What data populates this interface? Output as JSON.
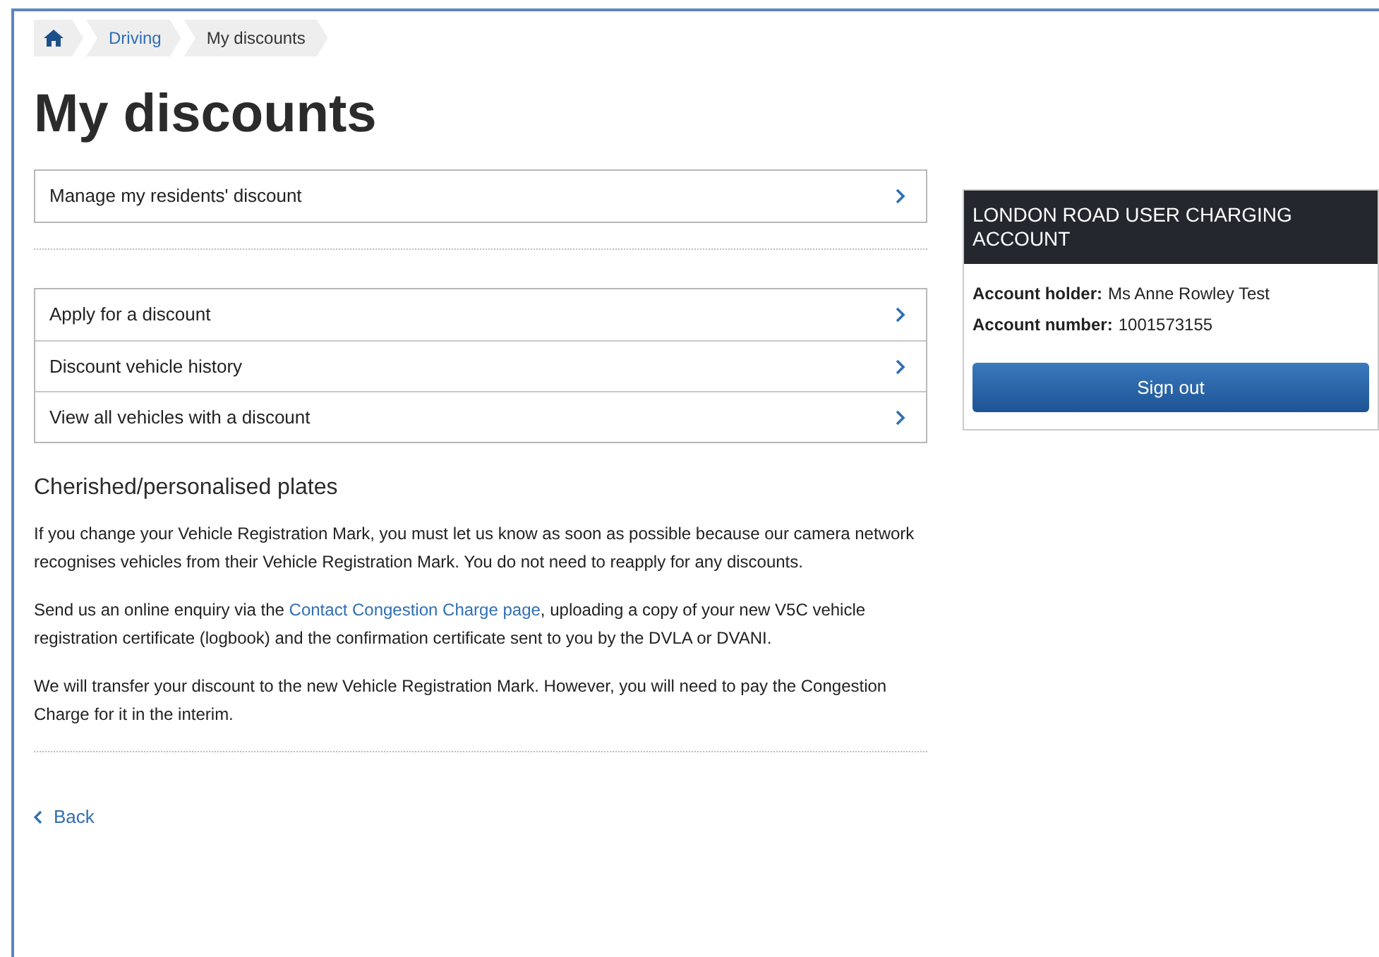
{
  "breadcrumb": [
    {
      "kind": "home"
    },
    {
      "kind": "link",
      "label": "Driving"
    },
    {
      "kind": "current",
      "label": "My discounts"
    }
  ],
  "title": "My discounts",
  "primary_links": [
    {
      "label": "Manage my residents' discount"
    }
  ],
  "secondary_links": [
    {
      "label": "Apply for a discount"
    },
    {
      "label": "Discount vehicle history"
    },
    {
      "label": "View all vehicles with a discount"
    }
  ],
  "section": {
    "heading": "Cherished/personalised plates",
    "paragraphs": [
      {
        "text": "If you change your Vehicle Registration Mark, you must let us know as soon as possible because our camera network recognises vehicles from their Vehicle Registration Mark. You do not need to reapply for any discounts."
      },
      {
        "text": "Send us an online enquiry via the ",
        "link": "Contact Congestion Charge page",
        "after": ", uploading a copy of your new V5C vehicle registration certificate (logbook) and the confirmation certificate sent to you by the DVLA or DVANI."
      },
      {
        "text": "We will transfer your discount to the new Vehicle Registration Mark. However, you will need to pay the Congestion Charge for it in the interim."
      }
    ]
  },
  "back_link": "Back",
  "account": {
    "title": "LONDON ROAD USER CHARGING ACCOUNT",
    "fields": [
      {
        "label": "Account holder:",
        "value": "Ms Anne Rowley Test"
      },
      {
        "label": "Account number:",
        "value": "1001573155"
      }
    ],
    "button": "Sign out"
  }
}
